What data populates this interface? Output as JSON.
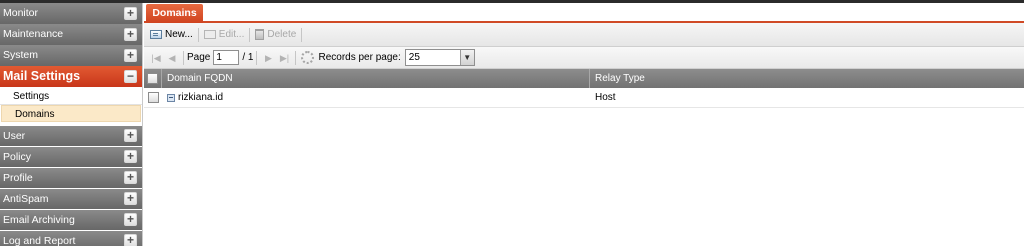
{
  "sidebar": {
    "items_before": [
      {
        "label": "Monitor"
      },
      {
        "label": "Maintenance"
      },
      {
        "label": "System"
      }
    ],
    "active": {
      "label": "Mail Settings",
      "toggle": "−"
    },
    "subitems": [
      {
        "label": "Settings",
        "selected": false
      },
      {
        "label": "Domains",
        "selected": true
      }
    ],
    "items_after": [
      {
        "label": "User"
      },
      {
        "label": "Policy"
      },
      {
        "label": "Profile"
      },
      {
        "label": "AntiSpam"
      },
      {
        "label": "Email Archiving"
      },
      {
        "label": "Log and Report"
      }
    ],
    "expand_glyph": "+"
  },
  "tab": {
    "label": "Domains"
  },
  "toolbar": {
    "new_label": "New...",
    "edit_label": "Edit...",
    "delete_label": "Delete"
  },
  "pager": {
    "page_label": "Page",
    "page_value": "1",
    "total_label": "/ 1",
    "records_label": "Records per page:",
    "records_value": "25"
  },
  "grid": {
    "columns": [
      "Domain FQDN",
      "Relay Type"
    ],
    "rows": [
      {
        "fqdn": "rizkiana.id",
        "relay": "Host"
      }
    ]
  },
  "colors": {
    "accent": "#d04a26",
    "header_gray": "#7a7a7a",
    "selected_bg": "#fbe9c8"
  }
}
